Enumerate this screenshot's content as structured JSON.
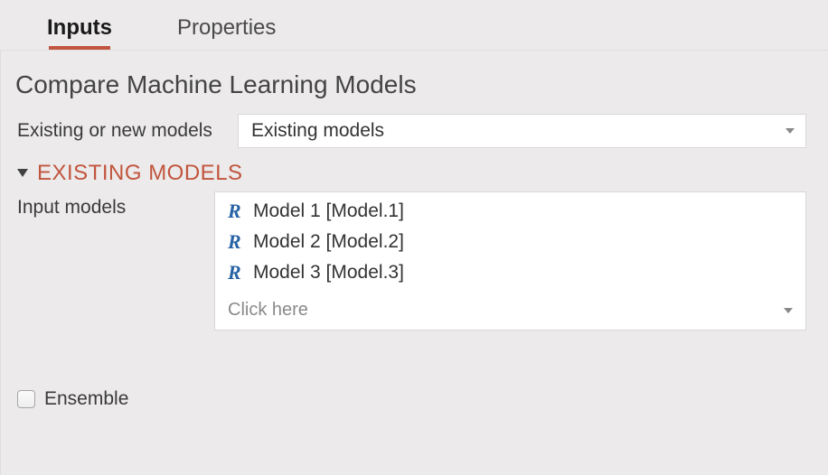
{
  "tabs": {
    "inputs": "Inputs",
    "properties": "Properties",
    "active": "inputs"
  },
  "page_title": "Compare Machine Learning Models",
  "model_source": {
    "label": "Existing or new models",
    "value": "Existing models"
  },
  "section_existing_models": {
    "title": "EXISTING MODELS",
    "expanded": true
  },
  "input_models": {
    "label": "Input models",
    "items": [
      {
        "label": "Model 1 [Model.1]"
      },
      {
        "label": "Model 2 [Model.2]"
      },
      {
        "label": "Model 3 [Model.3]"
      }
    ],
    "placeholder": "Click here"
  },
  "ensemble": {
    "label": "Ensemble",
    "checked": false
  }
}
